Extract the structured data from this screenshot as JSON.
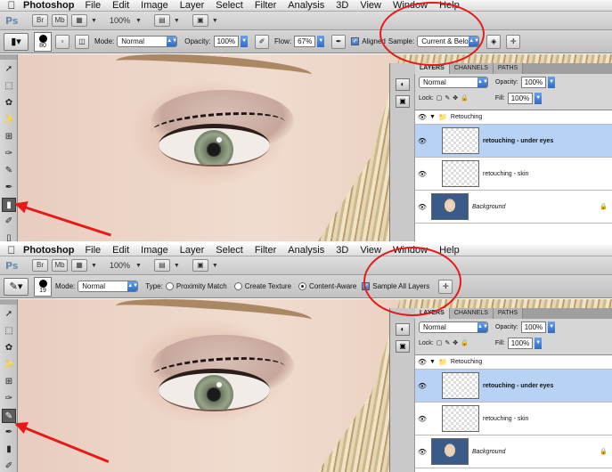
{
  "menu": {
    "app_name": "Photoshop",
    "items": [
      "File",
      "Edit",
      "Image",
      "Layer",
      "Select",
      "Filter",
      "Analysis",
      "3D",
      "View",
      "Window",
      "Help"
    ]
  },
  "appbar": {
    "logo": "Ps",
    "zoom": "100%"
  },
  "top": {
    "options": {
      "brush_size": "80",
      "mode_label": "Mode:",
      "mode_value": "Normal",
      "opacity_label": "Opacity:",
      "opacity_value": "100%",
      "flow_label": "Flow:",
      "flow_value": "67%",
      "aligned_label": "Aligned",
      "sample_label": "Sample:",
      "sample_value": "Current & Below"
    }
  },
  "bottom": {
    "options": {
      "brush_size": "19",
      "mode_label": "Mode:",
      "mode_value": "Normal",
      "type_label": "Type:",
      "radio_1": "Proximity Match",
      "radio_2": "Create Texture",
      "radio_3": "Content-Aware",
      "sample_all_label": "Sample All Layers"
    }
  },
  "layers_panel": {
    "tabs": [
      "LAYERS",
      "CHANNELS",
      "PATHS"
    ],
    "blend_mode": "Normal",
    "opacity_label": "Opacity:",
    "opacity_value": "100%",
    "lock_label": "Lock:",
    "fill_label": "Fill:",
    "fill_value": "100%",
    "group_name": "Retouching",
    "layers": [
      "retouching - under eyes",
      "retouching - skin",
      "Background"
    ]
  },
  "colors": {
    "annotation": "#e41b1b",
    "selection": "#b7d2f4"
  }
}
